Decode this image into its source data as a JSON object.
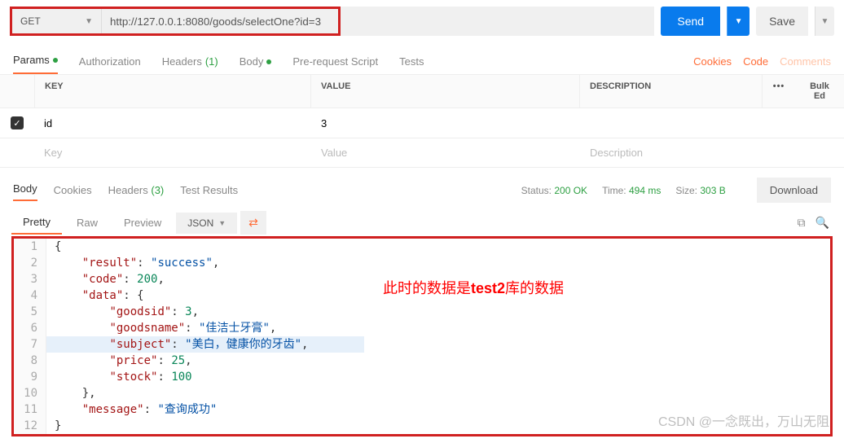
{
  "request": {
    "method": "GET",
    "url": "http://127.0.0.1:8080/goods/selectOne?id=3",
    "send": "Send",
    "save": "Save"
  },
  "tabs": {
    "params": "Params",
    "authorization": "Authorization",
    "headers": "Headers",
    "headers_count": "(1)",
    "body": "Body",
    "prerequest": "Pre-request Script",
    "tests": "Tests"
  },
  "links": {
    "cookies": "Cookies",
    "code": "Code",
    "comments": "Comments"
  },
  "params_header": {
    "key": "KEY",
    "value": "VALUE",
    "description": "DESCRIPTION",
    "bulk": "Bulk Ed"
  },
  "params_rows": [
    {
      "key": "id",
      "value": "3",
      "description": ""
    }
  ],
  "placeholders": {
    "key": "Key",
    "value": "Value",
    "desc": "Description"
  },
  "resp_tabs": {
    "body": "Body",
    "cookies": "Cookies",
    "headers": "Headers",
    "headers_count": "(3)",
    "test_results": "Test Results"
  },
  "status": {
    "status_label": "Status:",
    "status_value": "200 OK",
    "time_label": "Time:",
    "time_value": "494 ms",
    "size_label": "Size:",
    "size_value": "303 B",
    "download": "Download"
  },
  "view": {
    "pretty": "Pretty",
    "raw": "Raw",
    "preview": "Preview",
    "format": "JSON"
  },
  "response_lines": [
    {
      "n": 1,
      "html": "{"
    },
    {
      "n": 2,
      "html": "    <span class=\"j-key\">\"result\"</span>: <span class=\"j-str\">\"success\"</span>,"
    },
    {
      "n": 3,
      "html": "    <span class=\"j-key\">\"code\"</span>: <span class=\"j-num\">200</span>,"
    },
    {
      "n": 4,
      "html": "    <span class=\"j-key\">\"data\"</span>: {"
    },
    {
      "n": 5,
      "html": "        <span class=\"j-key\">\"goodsid\"</span>: <span class=\"j-num\">3</span>,"
    },
    {
      "n": 6,
      "html": "        <span class=\"j-key\">\"goodsname\"</span>: <span class=\"j-str\">\"佳洁士牙膏\"</span>,"
    },
    {
      "n": 7,
      "html": "        <span class=\"j-key\">\"subject\"</span>: <span class=\"j-str\">\"美白，健康你的牙齿\"</span>,",
      "hl": true
    },
    {
      "n": 8,
      "html": "        <span class=\"j-key\">\"price\"</span>: <span class=\"j-num\">25</span>,"
    },
    {
      "n": 9,
      "html": "        <span class=\"j-key\">\"stock\"</span>: <span class=\"j-num\">100</span>"
    },
    {
      "n": 10,
      "html": "    },"
    },
    {
      "n": 11,
      "html": "    <span class=\"j-key\">\"message\"</span>: <span class=\"j-str\">\"查询成功\"</span>"
    },
    {
      "n": 12,
      "html": "}"
    }
  ],
  "annotation": {
    "prefix": "此时的数据是",
    "bold": "test2",
    "suffix": "库的数据"
  },
  "watermark": "CSDN @一念既出，万山无阻"
}
